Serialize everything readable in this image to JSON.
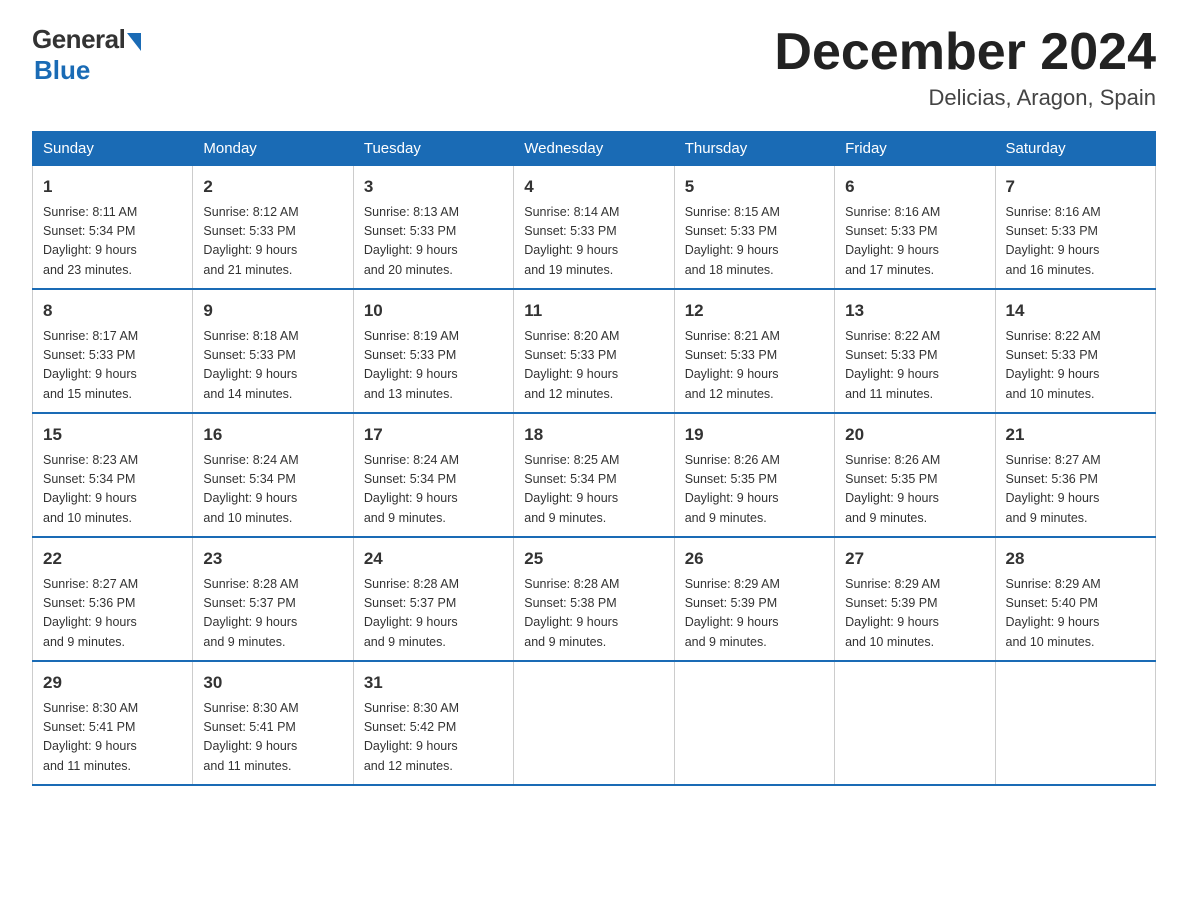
{
  "logo": {
    "general": "General",
    "blue": "Blue",
    "subtitle": "Blue"
  },
  "header": {
    "month_title": "December 2024",
    "location": "Delicias, Aragon, Spain"
  },
  "days_of_week": [
    "Sunday",
    "Monday",
    "Tuesday",
    "Wednesday",
    "Thursday",
    "Friday",
    "Saturday"
  ],
  "weeks": [
    [
      {
        "day": "1",
        "sunrise": "8:11 AM",
        "sunset": "5:34 PM",
        "daylight": "9 hours and 23 minutes."
      },
      {
        "day": "2",
        "sunrise": "8:12 AM",
        "sunset": "5:33 PM",
        "daylight": "9 hours and 21 minutes."
      },
      {
        "day": "3",
        "sunrise": "8:13 AM",
        "sunset": "5:33 PM",
        "daylight": "9 hours and 20 minutes."
      },
      {
        "day": "4",
        "sunrise": "8:14 AM",
        "sunset": "5:33 PM",
        "daylight": "9 hours and 19 minutes."
      },
      {
        "day": "5",
        "sunrise": "8:15 AM",
        "sunset": "5:33 PM",
        "daylight": "9 hours and 18 minutes."
      },
      {
        "day": "6",
        "sunrise": "8:16 AM",
        "sunset": "5:33 PM",
        "daylight": "9 hours and 17 minutes."
      },
      {
        "day": "7",
        "sunrise": "8:16 AM",
        "sunset": "5:33 PM",
        "daylight": "9 hours and 16 minutes."
      }
    ],
    [
      {
        "day": "8",
        "sunrise": "8:17 AM",
        "sunset": "5:33 PM",
        "daylight": "9 hours and 15 minutes."
      },
      {
        "day": "9",
        "sunrise": "8:18 AM",
        "sunset": "5:33 PM",
        "daylight": "9 hours and 14 minutes."
      },
      {
        "day": "10",
        "sunrise": "8:19 AM",
        "sunset": "5:33 PM",
        "daylight": "9 hours and 13 minutes."
      },
      {
        "day": "11",
        "sunrise": "8:20 AM",
        "sunset": "5:33 PM",
        "daylight": "9 hours and 12 minutes."
      },
      {
        "day": "12",
        "sunrise": "8:21 AM",
        "sunset": "5:33 PM",
        "daylight": "9 hours and 12 minutes."
      },
      {
        "day": "13",
        "sunrise": "8:22 AM",
        "sunset": "5:33 PM",
        "daylight": "9 hours and 11 minutes."
      },
      {
        "day": "14",
        "sunrise": "8:22 AM",
        "sunset": "5:33 PM",
        "daylight": "9 hours and 10 minutes."
      }
    ],
    [
      {
        "day": "15",
        "sunrise": "8:23 AM",
        "sunset": "5:34 PM",
        "daylight": "9 hours and 10 minutes."
      },
      {
        "day": "16",
        "sunrise": "8:24 AM",
        "sunset": "5:34 PM",
        "daylight": "9 hours and 10 minutes."
      },
      {
        "day": "17",
        "sunrise": "8:24 AM",
        "sunset": "5:34 PM",
        "daylight": "9 hours and 9 minutes."
      },
      {
        "day": "18",
        "sunrise": "8:25 AM",
        "sunset": "5:34 PM",
        "daylight": "9 hours and 9 minutes."
      },
      {
        "day": "19",
        "sunrise": "8:26 AM",
        "sunset": "5:35 PM",
        "daylight": "9 hours and 9 minutes."
      },
      {
        "day": "20",
        "sunrise": "8:26 AM",
        "sunset": "5:35 PM",
        "daylight": "9 hours and 9 minutes."
      },
      {
        "day": "21",
        "sunrise": "8:27 AM",
        "sunset": "5:36 PM",
        "daylight": "9 hours and 9 minutes."
      }
    ],
    [
      {
        "day": "22",
        "sunrise": "8:27 AM",
        "sunset": "5:36 PM",
        "daylight": "9 hours and 9 minutes."
      },
      {
        "day": "23",
        "sunrise": "8:28 AM",
        "sunset": "5:37 PM",
        "daylight": "9 hours and 9 minutes."
      },
      {
        "day": "24",
        "sunrise": "8:28 AM",
        "sunset": "5:37 PM",
        "daylight": "9 hours and 9 minutes."
      },
      {
        "day": "25",
        "sunrise": "8:28 AM",
        "sunset": "5:38 PM",
        "daylight": "9 hours and 9 minutes."
      },
      {
        "day": "26",
        "sunrise": "8:29 AM",
        "sunset": "5:39 PM",
        "daylight": "9 hours and 9 minutes."
      },
      {
        "day": "27",
        "sunrise": "8:29 AM",
        "sunset": "5:39 PM",
        "daylight": "9 hours and 10 minutes."
      },
      {
        "day": "28",
        "sunrise": "8:29 AM",
        "sunset": "5:40 PM",
        "daylight": "9 hours and 10 minutes."
      }
    ],
    [
      {
        "day": "29",
        "sunrise": "8:30 AM",
        "sunset": "5:41 PM",
        "daylight": "9 hours and 11 minutes."
      },
      {
        "day": "30",
        "sunrise": "8:30 AM",
        "sunset": "5:41 PM",
        "daylight": "9 hours and 11 minutes."
      },
      {
        "day": "31",
        "sunrise": "8:30 AM",
        "sunset": "5:42 PM",
        "daylight": "9 hours and 12 minutes."
      },
      null,
      null,
      null,
      null
    ]
  ]
}
